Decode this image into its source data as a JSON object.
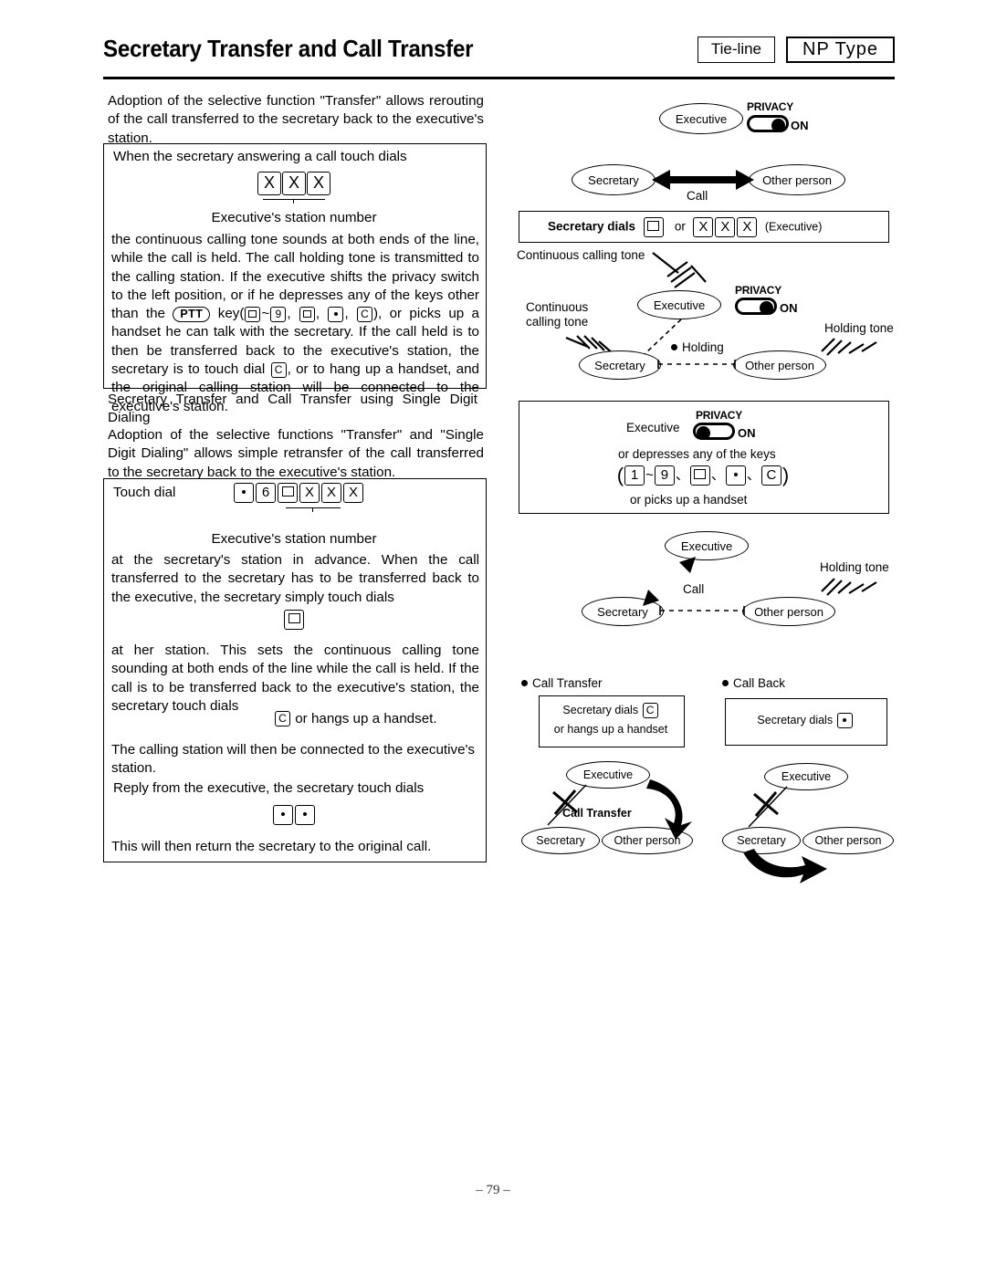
{
  "header": {
    "title": "Secretary Transfer and Call Transfer",
    "badge_tieline": "Tie-line",
    "badge_nptype": "NP Type"
  },
  "left_column": {
    "intro": "Adoption of the selective function \"Transfer\" allows rerouting of the call transferred to the secretary back to the executive's station.",
    "box1": {
      "line1": "When the secretary answering a call touch dials",
      "keys": [
        "X",
        "X",
        "X"
      ],
      "caption": "Executive's station number",
      "body_a": "the continuous calling tone sounds at both ends of the line, while the call is held. The call holding tone is transmitted to the calling station. If the executive shifts the privacy switch to the left position, or if he depresses any of the keys other than the",
      "ptt_label": "PTT",
      "body_b": "key",
      "key_list": [
        "0",
        "~",
        "9",
        "0",
        "•",
        "C"
      ],
      "body_c": ", or picks up a handset he can talk with the secretary. If the call held is to then be transferred back to the executive's station, the secretary is to touch dial",
      "key_c": "C",
      "body_d": ", or to hang up a handset, and the original calling station will be connected to the executive's station."
    },
    "subhead": "Secretary Transfer and Call Transfer using Single Digit Dialing",
    "para2": "Adoption of the selective functions \"Transfer\" and \"Single Digit Dialing\" allows simple retransfer of the call transferred to the secretary back to the executive's station.",
    "box2": {
      "touch_dial_label": "Touch dial",
      "keys": [
        "•",
        "6",
        "0",
        "X",
        "X",
        "X"
      ],
      "caption": "Executive's station number",
      "body_a": "at the secretary's station in advance. When the call transferred to the secretary has to be transferred back to the executive, the secretary simply touch dials",
      "key_mid": "0",
      "body_b": "at her station. This sets the continuous calling tone sounding at both ends of the line while the call is held. If the call is to be transferred back to the executive's station, the secretary touch dials",
      "key_c": "C",
      "hangup_text": "or hangs up a handset.",
      "body_c": "The calling station will then be connected to the executive's station.",
      "body_d": "Reply from the executive, the secretary touch dials",
      "keys_reply": [
        "•",
        "•"
      ],
      "body_e": "This will then return the secretary to the original call."
    }
  },
  "right_column": {
    "diagram1": {
      "executive": "Executive",
      "secretary": "Secretary",
      "other": "Other person",
      "call_label": "Call",
      "privacy_label": "PRIVACY",
      "on_label": "ON",
      "privacy_state": "right"
    },
    "box_dials": {
      "prefix": "Secretary dials",
      "key_zero": "0",
      "or_label": "or",
      "keys_x": [
        "X",
        "X",
        "X"
      ],
      "suffix": "(Executive)"
    },
    "diagram2": {
      "tone_top": "Continuous calling tone",
      "tone_left_l1": "Continuous",
      "tone_left_l2": "calling tone",
      "holding_tone": "Holding tone",
      "holding_label": "Holding",
      "executive": "Executive",
      "secretary": "Secretary",
      "other": "Other person",
      "privacy_label": "PRIVACY",
      "on_label": "ON",
      "privacy_state": "right"
    },
    "box_privacy": {
      "executive": "Executive",
      "privacy_label": "PRIVACY",
      "on_label": "ON",
      "privacy_state": "left",
      "line2": "or depresses any of the keys",
      "keys": [
        "1",
        "~",
        "9",
        "0",
        "•",
        "C"
      ],
      "line3": "or picks up a handset"
    },
    "diagram3": {
      "executive": "Executive",
      "secretary": "Secretary",
      "other": "Other person",
      "call_label": "Call",
      "holding_tone": "Holding tone"
    },
    "call_transfer": {
      "heading": "Call Transfer",
      "box_line1_prefix": "Secretary dials",
      "box_line1_key": "C",
      "box_line2": "or hangs up a handset",
      "executive": "Executive",
      "secretary": "Secretary",
      "other": "Other person",
      "arrow_label": "Call Transfer"
    },
    "call_back": {
      "heading": "Call Back",
      "box_line1_prefix": "Secretary dials",
      "box_line1_key": "•",
      "executive": "Executive",
      "secretary": "Secretary",
      "other": "Other person"
    }
  },
  "footer": {
    "page_number": "– 79 –"
  }
}
